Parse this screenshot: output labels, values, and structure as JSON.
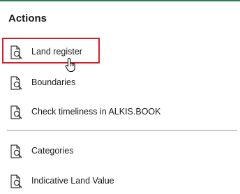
{
  "panel": {
    "title": "Actions"
  },
  "actions": [
    {
      "label": "Land register",
      "icon": "document-search-icon"
    },
    {
      "label": "Boundaries",
      "icon": "document-search-icon"
    },
    {
      "label": "Check timeliness in ALKIS.BOOK",
      "icon": "document-search-icon"
    },
    {
      "label": "Categories",
      "icon": "document-search-icon"
    },
    {
      "label": "Indicative Land Value",
      "icon": "document-search-icon"
    }
  ],
  "colors": {
    "accent": "#2e7d4f",
    "highlight": "#d0202a",
    "divider": "#c8c8c8"
  }
}
